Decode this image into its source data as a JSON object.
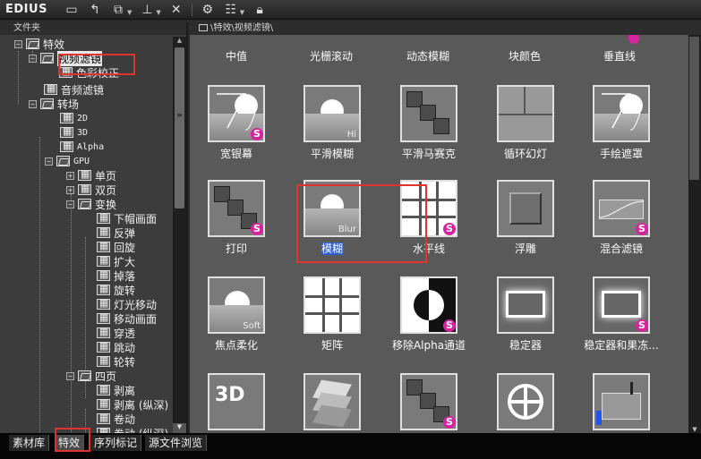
{
  "app": {
    "logo": "EDIUS"
  },
  "toolbar": {
    "icons": [
      "folder-icon",
      "folder-up-icon",
      "new-item-icon",
      "layer-icon",
      "delete-icon",
      "properties-icon",
      "view-icon",
      "lock-icon"
    ]
  },
  "left_panel": {
    "header": "文件夹",
    "tree": [
      {
        "label": "特效"
      },
      {
        "label": "视频滤镜"
      },
      {
        "label": "色彩校正"
      },
      {
        "label": "音频滤镜"
      },
      {
        "label": "转场"
      },
      {
        "label": "2D"
      },
      {
        "label": "3D"
      },
      {
        "label": "Alpha"
      },
      {
        "label": "GPU"
      },
      {
        "label": "单页"
      },
      {
        "label": "双页"
      },
      {
        "label": "变换"
      },
      {
        "label": "下帽画面"
      },
      {
        "label": "反弹"
      },
      {
        "label": "回旋"
      },
      {
        "label": "扩大"
      },
      {
        "label": "掉落"
      },
      {
        "label": "旋转"
      },
      {
        "label": "灯光移动"
      },
      {
        "label": "移动画面"
      },
      {
        "label": "穿透"
      },
      {
        "label": "跳动"
      },
      {
        "label": "轮转"
      },
      {
        "label": "四页"
      },
      {
        "label": "剥离"
      },
      {
        "label": "剥离 (纵深)"
      },
      {
        "label": "卷动"
      },
      {
        "label": "卷动 (纵深)"
      }
    ]
  },
  "right_panel": {
    "breadcrumb": "\\特效\\视频滤镜\\",
    "top_row": [
      "中值",
      "光栅滚动",
      "动态模糊",
      "块颜色",
      "垂直线"
    ],
    "tiles": [
      {
        "label": "宽银幕",
        "badge": "S"
      },
      {
        "label": "平滑模糊",
        "hint": "Hi"
      },
      {
        "label": "平滑马赛克"
      },
      {
        "label": "循环幻灯"
      },
      {
        "label": "手绘遮罩"
      },
      {
        "label": "打印",
        "badge": "S"
      },
      {
        "label": "模糊",
        "hint": "Blur",
        "selected": true
      },
      {
        "label": "水平线",
        "badge": "S"
      },
      {
        "label": "浮雕"
      },
      {
        "label": "混合滤镜",
        "badge": "S"
      },
      {
        "label": "焦点柔化",
        "hint": "Soft"
      },
      {
        "label": "矩阵"
      },
      {
        "label": "移除Alpha通道",
        "badge": "S"
      },
      {
        "label": "稳定器"
      },
      {
        "label": "稳定器和果冻...",
        "badge": "S"
      },
      {
        "label": ""
      },
      {
        "label": ""
      },
      {
        "label": "",
        "badge": "S"
      },
      {
        "label": ""
      },
      {
        "label": ""
      }
    ]
  },
  "bottom_tabs": [
    "素材库",
    "特效",
    "序列标记",
    "源文件浏览"
  ],
  "colors": {
    "badge": "#d6249f",
    "highlight": "#e0342e",
    "selection": "#2f5fc4"
  }
}
